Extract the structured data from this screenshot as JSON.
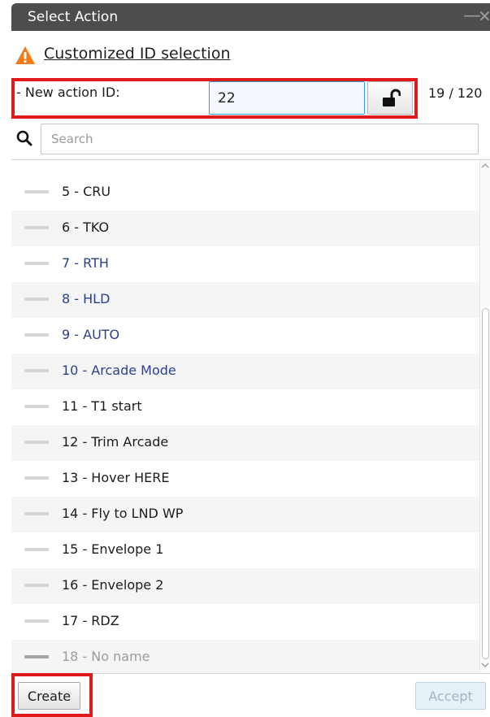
{
  "window": {
    "title": "Select Action",
    "minimize_glyph": "—",
    "close_glyph": "✕"
  },
  "warning": {
    "icon": "warning-triangle-icon",
    "icon_color": "#f07d1a",
    "link_text": "Customized ID selection"
  },
  "action_id": {
    "label": "- New action ID:",
    "value": "22",
    "lock_icon": "unlock-icon",
    "counter": "19 / 120"
  },
  "search": {
    "icon": "search-icon",
    "placeholder": "Search",
    "value": ""
  },
  "list": {
    "items": [
      {
        "label": "5 - CRU",
        "style": "normal"
      },
      {
        "label": "6 - TKO",
        "style": "normal"
      },
      {
        "label": "7 - RTH",
        "style": "blue"
      },
      {
        "label": "8 - HLD",
        "style": "blue"
      },
      {
        "label": "9 - AUTO",
        "style": "blue"
      },
      {
        "label": "10 - Arcade Mode",
        "style": "blue"
      },
      {
        "label": "11 - T1 start",
        "style": "normal"
      },
      {
        "label": "12 - Trim Arcade",
        "style": "normal"
      },
      {
        "label": "13 - Hover HERE",
        "style": "normal"
      },
      {
        "label": "14 - Fly to LND WP",
        "style": "normal"
      },
      {
        "label": "15 - Envelope 1",
        "style": "normal"
      },
      {
        "label": "16 - Envelope 2",
        "style": "normal"
      },
      {
        "label": "17 - RDZ",
        "style": "normal"
      },
      {
        "label": "18 - No name",
        "style": "dim"
      }
    ],
    "scroll_position": 0.43
  },
  "footer": {
    "create_label": "Create",
    "accept_label": "Accept"
  },
  "colors": {
    "highlight": "#e0191b",
    "titlebar": "#4d4d4d",
    "link_blue": "#2a3f8f",
    "input_focus": "#2f9ee0"
  }
}
